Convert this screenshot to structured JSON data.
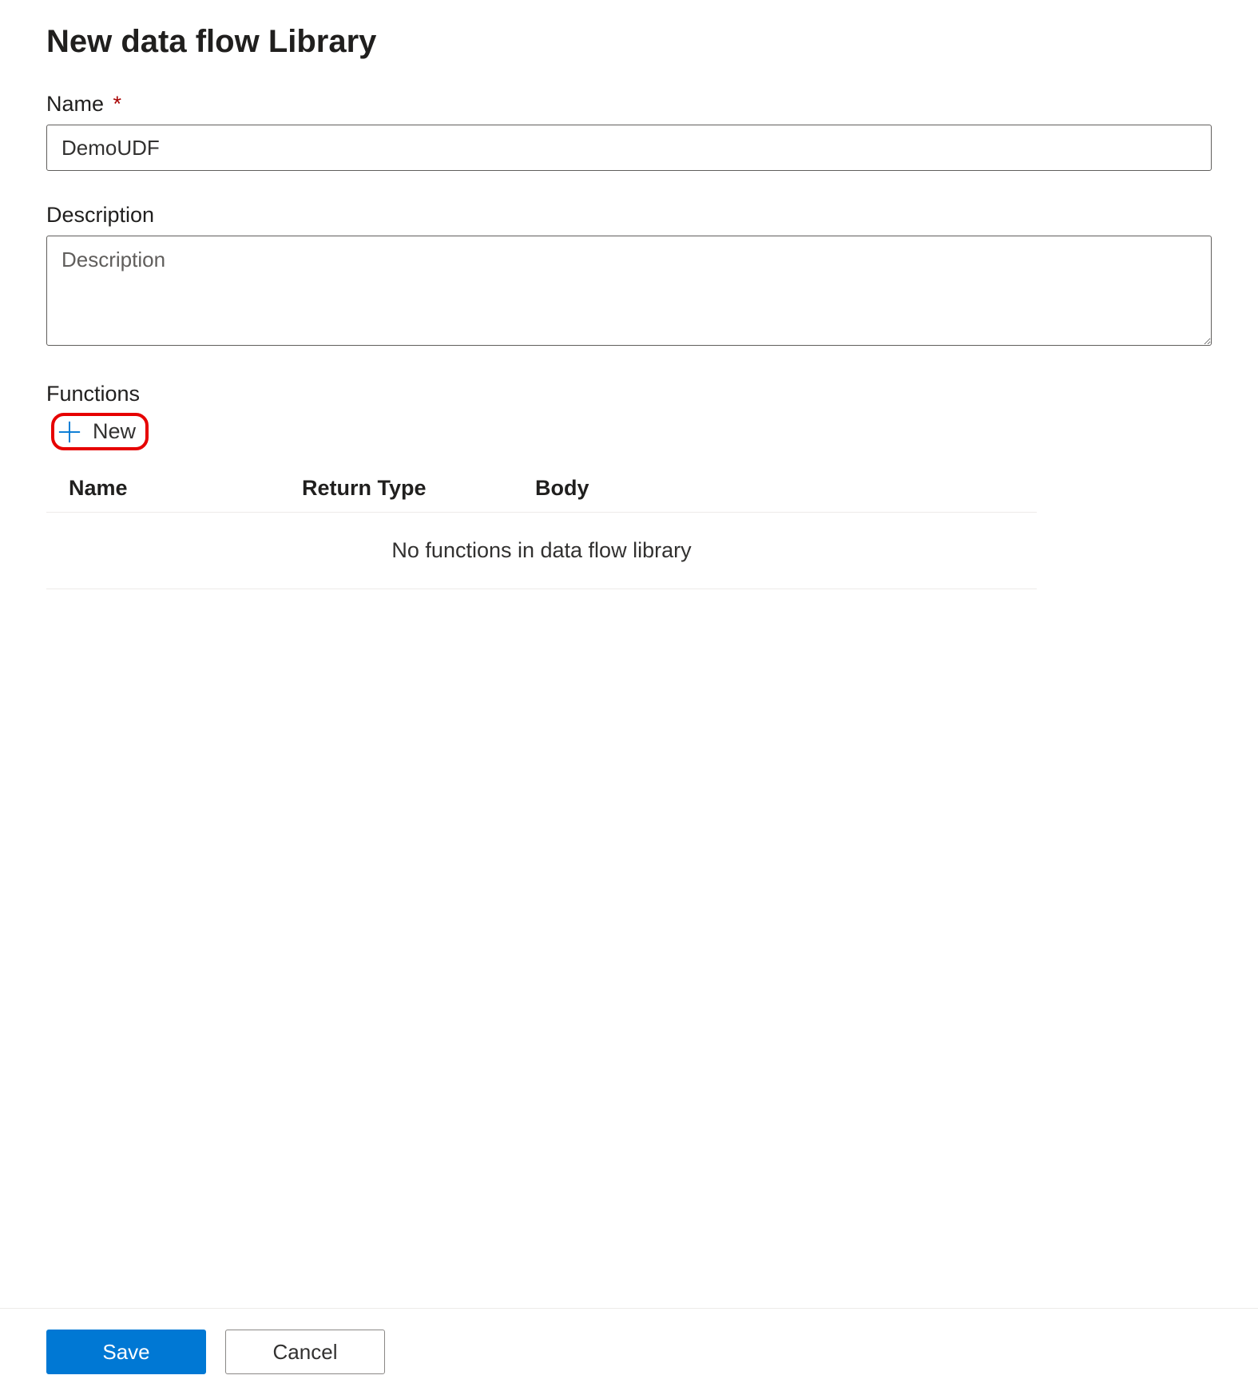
{
  "title": "New data flow Library",
  "fields": {
    "name": {
      "label": "Name",
      "required": "*",
      "value": "DemoUDF"
    },
    "description": {
      "label": "Description",
      "placeholder": "Description",
      "value": ""
    }
  },
  "functions": {
    "label": "Functions",
    "new_label": "New",
    "columns": {
      "name": "Name",
      "return_type": "Return Type",
      "body": "Body"
    },
    "empty_message": "No functions in data flow library",
    "rows": []
  },
  "footer": {
    "save_label": "Save",
    "cancel_label": "Cancel"
  },
  "colors": {
    "accent": "#0078d4",
    "highlight_border": "#e60000"
  }
}
